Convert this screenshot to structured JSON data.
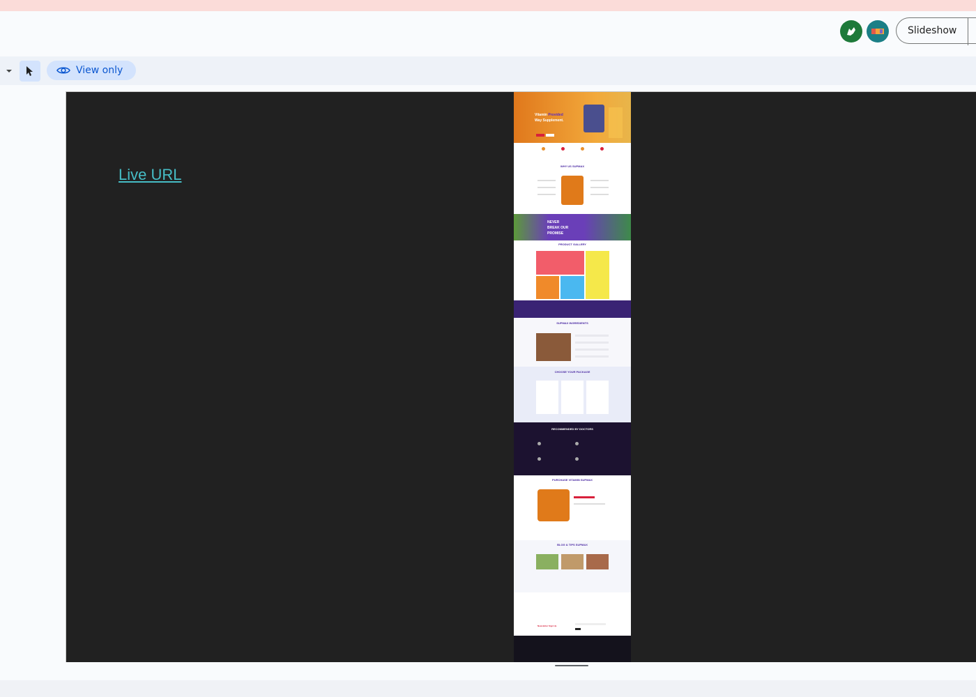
{
  "header": {
    "slideshow_label": "Slideshow"
  },
  "toolbar": {
    "view_only_label": "View only"
  },
  "slide": {
    "link_text": "Live URL"
  },
  "screenshot": {
    "hero_title_1": "Vitamin",
    "hero_title_accent": "Provided",
    "hero_title_2": "Way Supplement.",
    "why_title": "WHY US SUPMAX",
    "promise_line1": "NEVER",
    "promise_line2": "BREAK OUR",
    "promise_line3": "PROMISE",
    "gallery_title": "PRODUCT GALLERY",
    "ingredients_title": "SUPMAX INGREDIENTS",
    "package_title": "CHOOSE YOUR PACKAGE",
    "doctors_title": "RECOMMENDED BY DOCTORS",
    "purchase_title": "PURCHASE VITAMIN SUPMAX",
    "news_title": "BLOG & TIPS SUPMAX",
    "newsletter_title": "Newsletter Sign Up"
  }
}
